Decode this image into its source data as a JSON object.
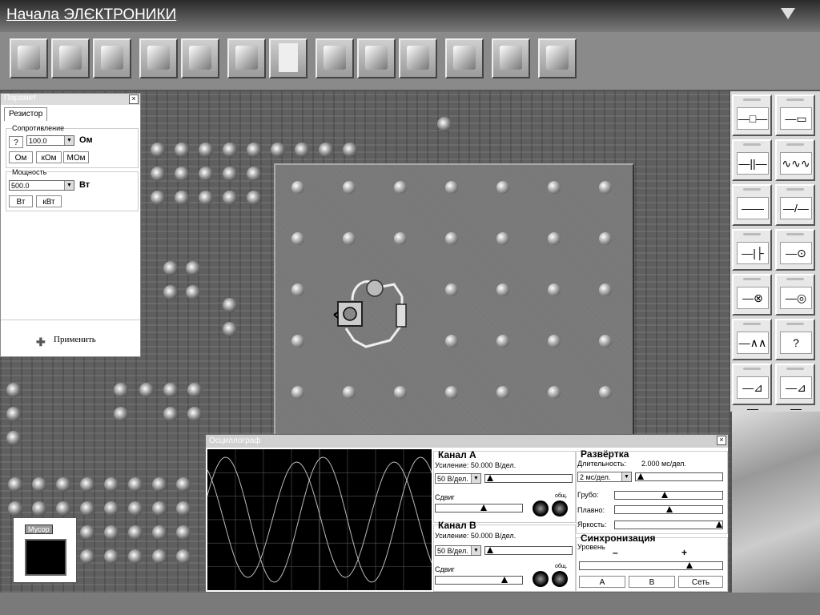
{
  "app": {
    "title": "Начала ЭЛЄКТРОНИКИ"
  },
  "params": {
    "title": "Парамет",
    "tab": "Резистор",
    "resistance": {
      "label": "Сопротивление",
      "help": "?",
      "value": "100.0",
      "unit": "Ом",
      "units": [
        "Ом",
        "кОм",
        "МОм"
      ]
    },
    "power": {
      "label": "Мощность",
      "value": "500.0",
      "unit": "Вт",
      "units": [
        "Вт",
        "кВт"
      ]
    },
    "apply": "Применить"
  },
  "trash": {
    "label": "Мусор"
  },
  "palette": {
    "symbols": [
      "—□—",
      "—▭—",
      "—||—",
      "∿∿∿",
      "——",
      "—/—",
      "—|├—",
      "—⊙—",
      "—⊗—",
      "—◎—",
      "—∧∧—",
      "?",
      "—⊿—",
      "—⊿—"
    ]
  },
  "oscilloscope": {
    "title": "Осциллограф",
    "channel_a": {
      "title": "Канал А",
      "gain_label": "Усиление: 50.000 В/дел.",
      "gain_value": "50 В/дел.",
      "gain_level": 0.0,
      "shift_label": "Сдвиг",
      "shift_level": 0.55,
      "knob_label": "общ."
    },
    "channel_b": {
      "title": "Канал В",
      "gain_label": "Усиление: 50.000 В/дел.",
      "gain_value": "50 В/дел.",
      "gain_level": 0.0,
      "shift_label": "Сдвиг",
      "shift_level": 0.82,
      "knob_label": "общ."
    },
    "sweep": {
      "title": "Развёртка",
      "duration_label": "Длительность:",
      "duration_value": "2.000 мс/дел.",
      "select_value": "2 мс/дел.",
      "select_level": 0.0,
      "coarse_label": "Грубо:",
      "coarse_level": 0.45,
      "fine_label": "Плавно:",
      "fine_level": 0.5,
      "brightness_label": "Яркость:",
      "brightness_level": 1.0
    },
    "sync": {
      "title": "Синхронизация",
      "level_label": "Уровень",
      "minus": "–",
      "plus": "+",
      "level": 0.78,
      "buttons": [
        "А",
        "В",
        "Сеть"
      ]
    }
  }
}
